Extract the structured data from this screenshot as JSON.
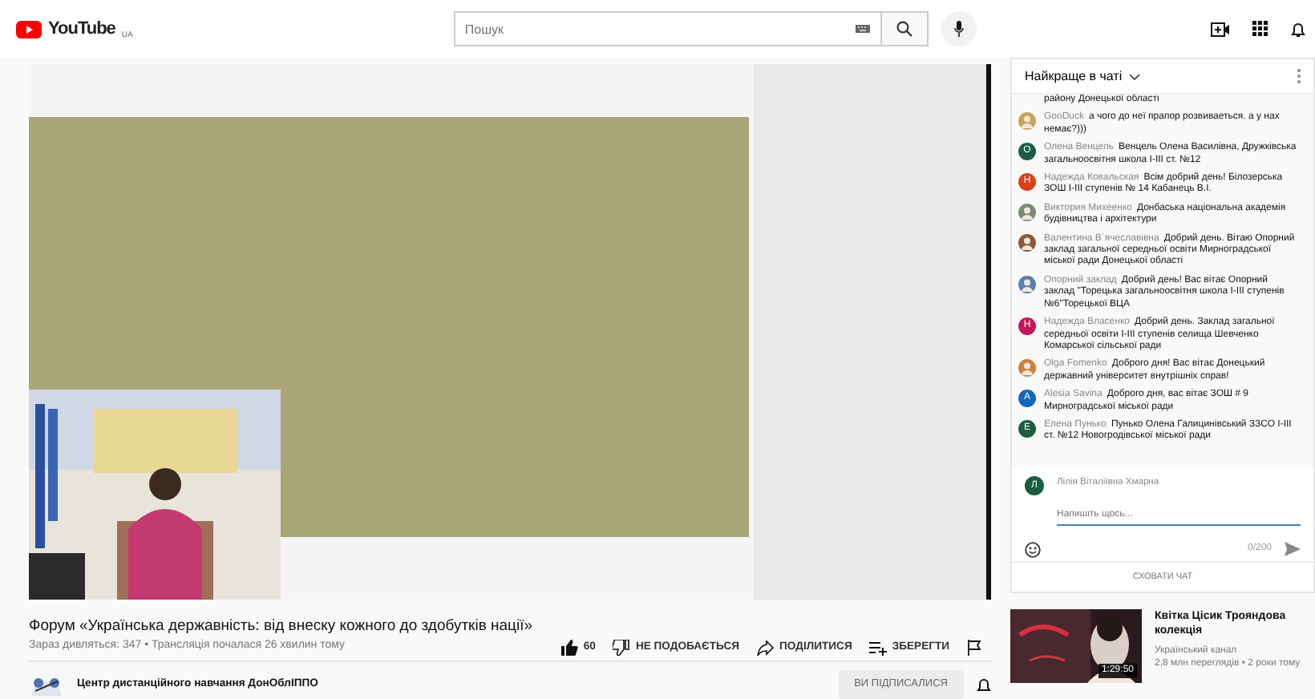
{
  "header": {
    "logo_text": "YouTube",
    "region": "UA",
    "search": {
      "placeholder": "Пошук"
    }
  },
  "chat": {
    "title": "Найкраще в чаті",
    "messages": [
      {
        "kind": "continuation",
        "text": "району Донецької області"
      },
      {
        "kind": "message",
        "author": "GooDuck",
        "text": "а чого до неї прапор розвиваеться. а у нах немає?)))"
      },
      {
        "kind": "message",
        "author": "Олена Венцель",
        "text": "Венцель Олена Василівна, Дружківська загальноосвітня школа І-ІІІ ст. №12",
        "avatar": {
          "kind": "letter",
          "letter": "О",
          "color": "#1f5b4b"
        }
      },
      {
        "kind": "message",
        "author": "Надежда Ковальская",
        "text": "Всім добрий день! Білозерська ЗОШ І-ІІІ ступенів № 14 Кабанець В.І.",
        "avatar": {
          "kind": "letter",
          "letter": "Н",
          "color": "#d4421a"
        }
      },
      {
        "kind": "message",
        "author": "Виктория Михеенко",
        "text": "Донбаська національна академія будівництва і архітектури"
      },
      {
        "kind": "message",
        "author": "Валентина В`ячеславівна",
        "text": "Добрий день. Вітаю Опорний заклад загальної середньої освіти Мирноградської міської ради Донецької області"
      },
      {
        "kind": "message",
        "author": "Опорний заклад",
        "text": "Добрий день! Вас вітає Опорний заклад \"Торецька загальноосвітня школа І-ІІІ ступенів №6\"Торецької ВЦА"
      },
      {
        "kind": "message",
        "author": "Надежда Власенко",
        "text": "Добрий день. Заклад загальної середньої освіти І-ІІІ ступенів селища Шевченко Комарської сільської ради",
        "avatar": {
          "kind": "letter",
          "letter": "Н",
          "color": "#c2185b"
        }
      },
      {
        "kind": "message",
        "author": "Olga Fomenko",
        "text": "Доброго дня! Вас вітає Донецький державний університет внутрішніх справ!"
      },
      {
        "kind": "message",
        "author": "Alesia Savina",
        "text": "Доброго дня, вас вітає ЗОШ # 9 Мирноградської міської ради",
        "avatar": {
          "kind": "letter",
          "letter": "A",
          "color": "#1565c0"
        }
      },
      {
        "kind": "message",
        "author": "Елена Пунько",
        "text": "Пунько Олена Галицинівський ЗЗСО І-ІІІ ст. №12 Новогродівської міської ради",
        "avatar": {
          "kind": "letter",
          "letter": "E",
          "color": "#1b5e3f"
        }
      }
    ],
    "input": {
      "user_name": "Лілія Віталіївна Хмарна",
      "avatar": {
        "kind": "letter",
        "letter": "Л",
        "color": "#1b5e3f"
      },
      "placeholder": "Напишіть щось...",
      "counter": "0/200"
    },
    "hide_button": "СХОВАТИ ЧАТ"
  },
  "video_info": {
    "title": "Форум «Українська державність: від внеску кожного до здобутків нації»",
    "meta": "Зараз дивляться: 347 • Трансляція почалася 26 хвилин тому",
    "actions": [
      {
        "kind": "like",
        "label": "60"
      },
      {
        "kind": "dislike",
        "label": "НЕ ПОДОБАЄТЬСЯ"
      },
      {
        "kind": "share",
        "label": "ПОДІЛИТИСЯ"
      },
      {
        "kind": "save",
        "label": "ЗБЕРЕГТИ"
      },
      {
        "kind": "report"
      }
    ]
  },
  "channel": {
    "name": "Центр дистанційного навчання ДонОблІППО",
    "subscribe_button": "ВИ ПІДПИСАЛИСЯ"
  },
  "recommendations": [
    {
      "kind": "picture",
      "duration": "1:29:50",
      "title": "Квітка Цісик Трояндова колекція",
      "channel": "Український канал",
      "meta": "2,8 млн переглядів • 2 роки тому"
    }
  ]
}
